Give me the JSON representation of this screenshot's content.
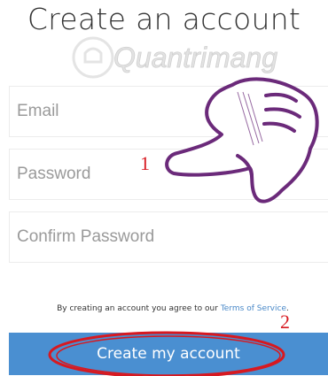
{
  "page": {
    "title": "Create an account",
    "watermark": "Quantrimang"
  },
  "form": {
    "email_placeholder": "Email",
    "password_placeholder": "Password",
    "confirm_password_placeholder": "Confirm Password",
    "terms_prefix": "By creating an account you agree to our",
    "terms_link": "Terms of Service",
    "terms_suffix": ".",
    "submit_label": "Create my account"
  },
  "annotations": {
    "marker_1": "1",
    "marker_2": "2"
  },
  "colors": {
    "button": "#4a8fd1",
    "link": "#4a89c8",
    "annotation_red": "#d71920",
    "hand_outline": "#6b2a7a"
  },
  "icons": {
    "pointing_hand": "pointing-hand-icon",
    "highlight_oval": "red-oval-annotation"
  }
}
